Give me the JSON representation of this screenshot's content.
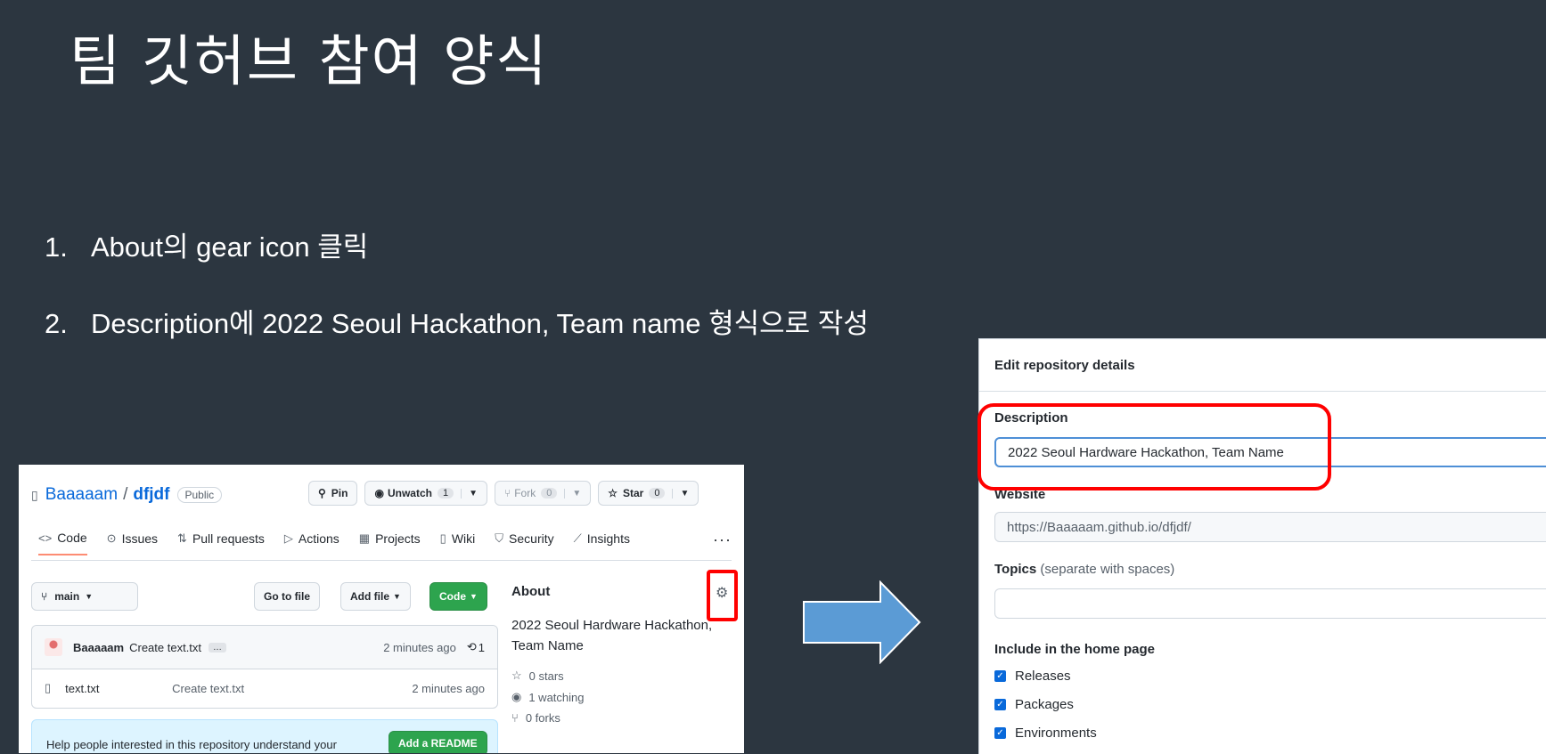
{
  "slide": {
    "title": "팀 깃허브 참여 양식",
    "steps": [
      {
        "num": "1.",
        "text": "About의 gear icon 클릭"
      },
      {
        "num": "2.",
        "text": "Description에 2022 Seoul Hackathon, Team name 형식으로 작성"
      }
    ]
  },
  "repo": {
    "owner": "Baaaaam",
    "separator": "/",
    "name": "dfjdf",
    "visibility": "Public",
    "pin_label": "Pin",
    "unwatch_label": "Unwatch",
    "unwatch_count": "1",
    "fork_label": "Fork",
    "fork_count": "0",
    "star_label": "Star",
    "star_count": "0",
    "tabs": [
      "Code",
      "Issues",
      "Pull requests",
      "Actions",
      "Projects",
      "Wiki",
      "Security",
      "Insights"
    ],
    "more_label": "···",
    "branch": "main",
    "goto_file": "Go to file",
    "add_file": "Add file",
    "code_button": "Code",
    "commit": {
      "author": "Baaaaam",
      "message": "Create text.txt",
      "ellipsis": "…",
      "time": "2 minutes ago",
      "count": "1"
    },
    "files": [
      {
        "name": "text.txt",
        "message": "Create text.txt",
        "time": "2 minutes ago"
      }
    ],
    "readme_prompt": "Help people interested in this repository understand your",
    "readme_button": "Add a README",
    "about": {
      "title": "About",
      "description": "2022 Seoul Hardware Hackathon, Team Name",
      "stars": "0 stars",
      "watching": "1 watching",
      "forks": "0 forks"
    }
  },
  "dialog": {
    "title": "Edit repository details",
    "description_label": "Description",
    "description_value": "2022 Seoul Hardware Hackathon, Team Name",
    "website_label": "Website",
    "website_value": "https://Baaaaam.github.io/dfjdf/",
    "topics_label": "Topics",
    "topics_hint": "(separate with spaces)",
    "home_label": "Include in the home page",
    "options": [
      "Releases",
      "Packages",
      "Environments"
    ]
  },
  "colors": {
    "background": "#2c3640",
    "highlight": "#ff0000",
    "arrow": "#5b9bd5",
    "github_green": "#2da44e",
    "link_blue": "#0969da"
  }
}
